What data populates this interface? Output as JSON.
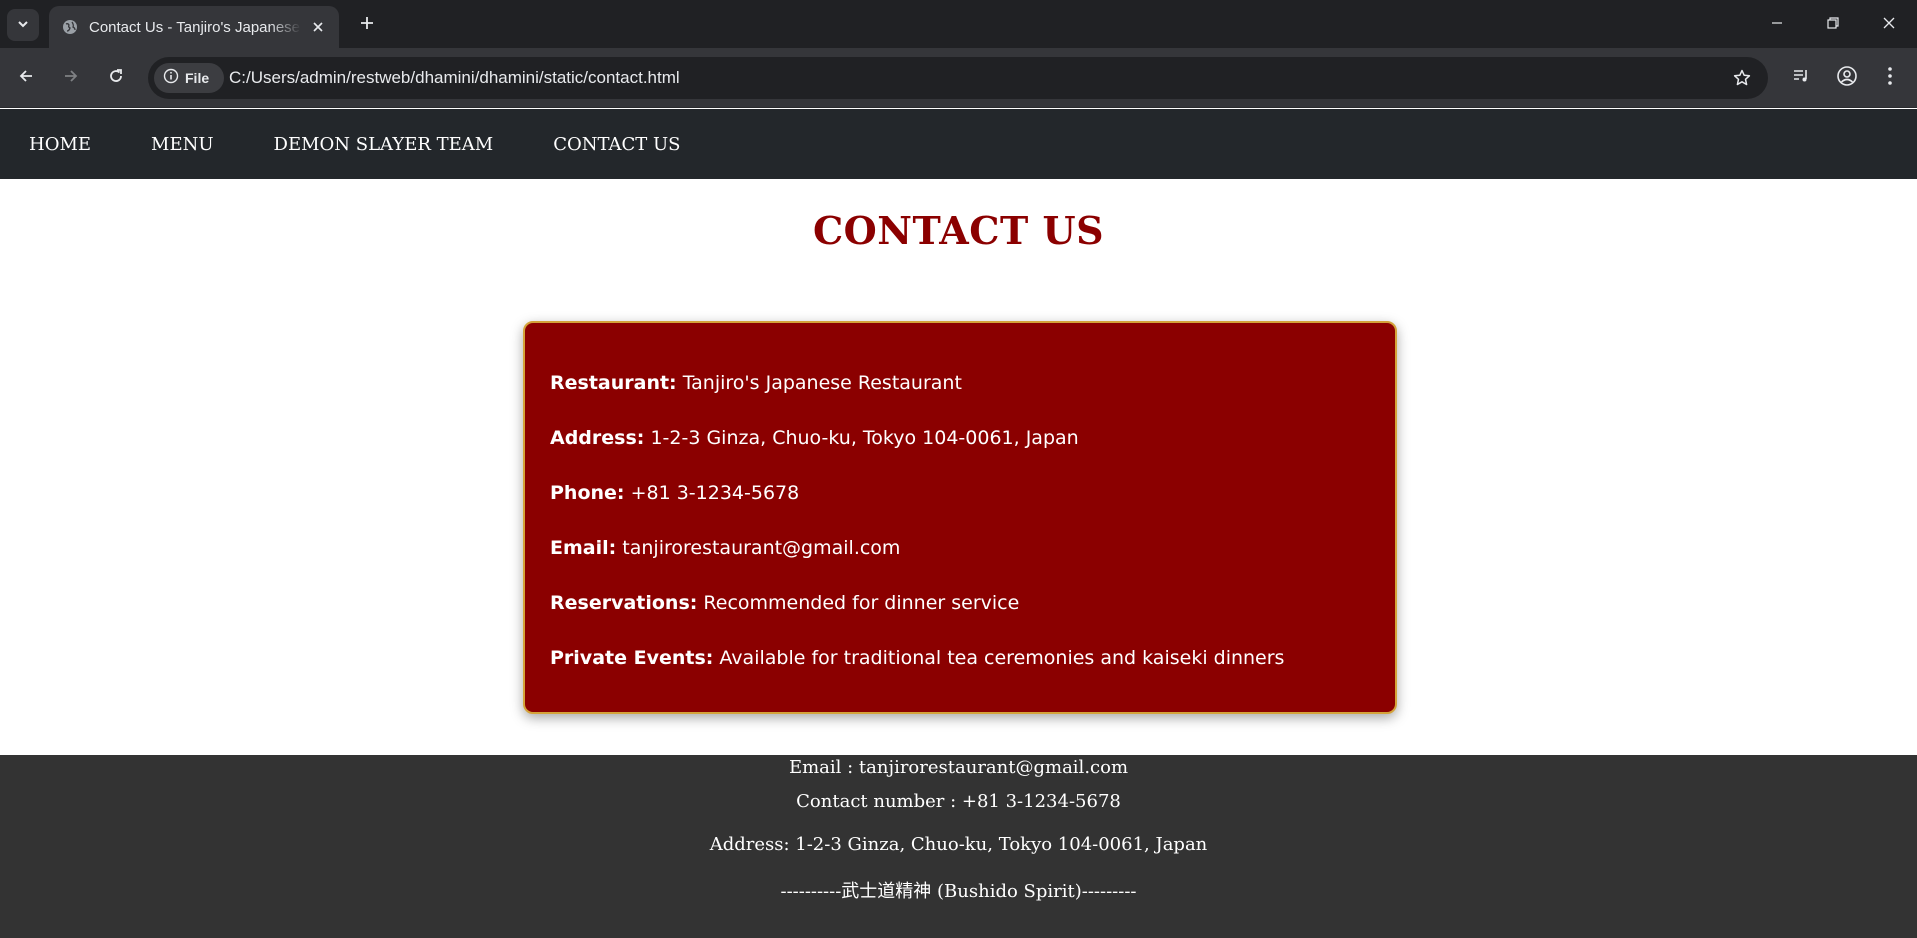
{
  "browser": {
    "tab_title": "Contact Us - Tanjiro's Japanese Restaurant",
    "security_chip": "File",
    "url": "C:/Users/admin/restweb/dhamini/dhamini/static/contact.html"
  },
  "nav": {
    "items": [
      {
        "label": "HOME"
      },
      {
        "label": "MENU"
      },
      {
        "label": "DEMON SLAYER TEAM"
      },
      {
        "label": "CONTACT US"
      }
    ]
  },
  "main": {
    "title": "CONTACT US",
    "contact": [
      {
        "label": "Restaurant:",
        "value": "Tanjiro's Japanese Restaurant"
      },
      {
        "label": "Address:",
        "value": "1-2-3 Ginza, Chuo-ku, Tokyo 104-0061, Japan"
      },
      {
        "label": "Phone:",
        "value": "+81 3-1234-5678"
      },
      {
        "label": "Email:",
        "value": "tanjirorestaurant@gmail.com"
      },
      {
        "label": "Reservations:",
        "value": "Recommended for dinner service"
      },
      {
        "label": "Private Events:",
        "value": "Available for traditional tea ceremonies and kaiseki dinners"
      }
    ]
  },
  "footer": {
    "email": "Email : tanjirorestaurant@gmail.com",
    "contact_number": "Contact number : +81 3-1234-5678",
    "address": "Address: 1-2-3 Ginza, Chuo-ku, Tokyo 104-0061, Japan",
    "motto": "----------武士道精神 (Bushido Spirit)---------"
  },
  "colors": {
    "accent": "#8b0000",
    "card_border": "#d4a33a",
    "nav_bg": "#23272b",
    "footer_bg": "#333333"
  },
  "icons": {
    "tab_list": "chevron-down-icon",
    "favicon": "globe-icon",
    "tab_close": "close-icon",
    "new_tab": "plus-icon",
    "back": "back-arrow-icon",
    "forward": "forward-arrow-icon",
    "reload": "reload-icon",
    "info": "info-icon",
    "bookmark": "star-icon",
    "media": "media-queue-icon",
    "profile": "profile-icon",
    "menu": "kebab-menu-icon",
    "minimize": "minimize-icon",
    "restore": "restore-icon",
    "close_window": "close-window-icon"
  }
}
